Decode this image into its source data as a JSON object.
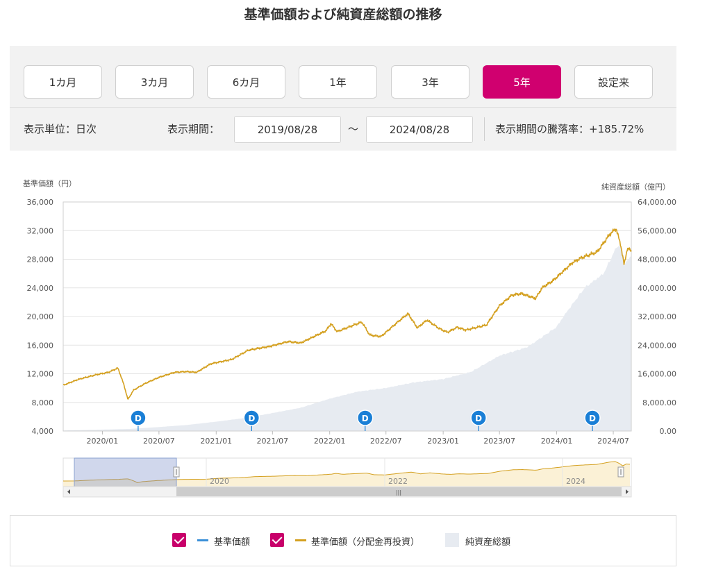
{
  "page": {
    "title": "基準価額および純資産総額の推移"
  },
  "period_buttons": [
    {
      "label": "1カ月",
      "active": false
    },
    {
      "label": "3カ月",
      "active": false
    },
    {
      "label": "6カ月",
      "active": false
    },
    {
      "label": "1年",
      "active": false
    },
    {
      "label": "3年",
      "active": false
    },
    {
      "label": "5年",
      "active": true
    },
    {
      "label": "設定来",
      "active": false
    }
  ],
  "controls": {
    "unit_label": "表示単位：日次",
    "period_label": "表示期間：",
    "start_date": "2019/08/28",
    "tilde": "～",
    "end_date": "2024/08/28",
    "change_label": "表示期間の騰落率：+185.72%"
  },
  "colors": {
    "accent": "#d0006f",
    "nav_reinvested_line": "#d4a020",
    "nav_line": "#3a8fd8",
    "net_assets_area": "#e7ebf1",
    "dividend_marker": "#1a7fd6"
  },
  "chart_data": {
    "type": "line",
    "left_axis_title": "基準価額（円）",
    "right_axis_title": "純資産総額（億円）",
    "left_ylim": [
      4000,
      36000
    ],
    "right_ylim": [
      0,
      64000
    ],
    "left_ticks": [
      "36,000",
      "32,000",
      "28,000",
      "24,000",
      "20,000",
      "16,000",
      "12,000",
      "8,000",
      "4,000"
    ],
    "right_ticks": [
      "64,000.00",
      "56,000.00",
      "48,000.00",
      "40,000.00",
      "32,000.00",
      "24,000.00",
      "16,000.00",
      "8,000.00",
      "0.00"
    ],
    "xlim": [
      "2019-08-28",
      "2024-08-28"
    ],
    "x_ticks": [
      {
        "date": "2020-01-01",
        "label": "2020/01"
      },
      {
        "date": "2020-07-01",
        "label": "2020/07"
      },
      {
        "date": "2021-01-01",
        "label": "2021/01"
      },
      {
        "date": "2021-07-01",
        "label": "2021/07"
      },
      {
        "date": "2022-01-01",
        "label": "2022/01"
      },
      {
        "date": "2022-07-01",
        "label": "2022/07"
      },
      {
        "date": "2023-01-01",
        "label": "2023/01"
      },
      {
        "date": "2023-07-01",
        "label": "2023/07"
      },
      {
        "date": "2024-01-01",
        "label": "2024/01"
      },
      {
        "date": "2024-07-01",
        "label": "2024/07"
      }
    ],
    "dividend_markers": {
      "label": "D",
      "dates": [
        "2020-04-25",
        "2021-04-25",
        "2022-04-25",
        "2023-04-25",
        "2024-04-25"
      ]
    },
    "series": [
      {
        "name": "基準価額（分配金再投資）",
        "axis": "left",
        "points": [
          [
            "2019-08-28",
            10400
          ],
          [
            "2019-10-15",
            11200
          ],
          [
            "2019-12-15",
            11900
          ],
          [
            "2020-01-20",
            12200
          ],
          [
            "2020-02-20",
            12800
          ],
          [
            "2020-03-10",
            10500
          ],
          [
            "2020-03-23",
            8400
          ],
          [
            "2020-04-10",
            9700
          ],
          [
            "2020-05-20",
            10700
          ],
          [
            "2020-07-01",
            11500
          ],
          [
            "2020-08-20",
            12200
          ],
          [
            "2020-09-25",
            12300
          ],
          [
            "2020-10-30",
            12200
          ],
          [
            "2020-12-15",
            13400
          ],
          [
            "2021-02-20",
            14000
          ],
          [
            "2021-04-15",
            15300
          ],
          [
            "2021-06-20",
            15800
          ],
          [
            "2021-08-20",
            16500
          ],
          [
            "2021-09-30",
            16300
          ],
          [
            "2021-12-20",
            18000
          ],
          [
            "2022-01-05",
            19000
          ],
          [
            "2022-01-25",
            17900
          ],
          [
            "2022-03-25",
            18900
          ],
          [
            "2022-04-15",
            19200
          ],
          [
            "2022-05-10",
            17400
          ],
          [
            "2022-06-15",
            17200
          ],
          [
            "2022-08-15",
            19500
          ],
          [
            "2022-09-10",
            20400
          ],
          [
            "2022-10-10",
            18400
          ],
          [
            "2022-11-10",
            19500
          ],
          [
            "2022-12-20",
            18300
          ],
          [
            "2023-01-15",
            17800
          ],
          [
            "2023-02-15",
            18500
          ],
          [
            "2023-03-15",
            18100
          ],
          [
            "2023-05-20",
            18800
          ],
          [
            "2023-07-01",
            21500
          ],
          [
            "2023-08-10",
            23000
          ],
          [
            "2023-09-10",
            23200
          ],
          [
            "2023-10-25",
            22500
          ],
          [
            "2023-11-15",
            24000
          ],
          [
            "2023-12-20",
            25000
          ],
          [
            "2024-02-20",
            27500
          ],
          [
            "2024-03-20",
            28200
          ],
          [
            "2024-05-10",
            29000
          ],
          [
            "2024-06-20",
            31500
          ],
          [
            "2024-07-10",
            32300
          ],
          [
            "2024-07-25",
            30000
          ],
          [
            "2024-08-05",
            27200
          ],
          [
            "2024-08-15",
            29500
          ],
          [
            "2024-08-28",
            29200
          ]
        ]
      },
      {
        "name": "純資産総額",
        "axis": "right",
        "points": [
          [
            "2019-08-28",
            150
          ],
          [
            "2019-12-31",
            400
          ],
          [
            "2020-03-31",
            600
          ],
          [
            "2020-06-30",
            1100
          ],
          [
            "2020-09-30",
            1700
          ],
          [
            "2020-12-31",
            2600
          ],
          [
            "2021-03-31",
            3600
          ],
          [
            "2021-06-30",
            5000
          ],
          [
            "2021-09-30",
            6500
          ],
          [
            "2021-12-31",
            9000
          ],
          [
            "2022-03-31",
            11000
          ],
          [
            "2022-06-30",
            12000
          ],
          [
            "2022-09-30",
            13600
          ],
          [
            "2022-12-31",
            14500
          ],
          [
            "2023-03-31",
            16500
          ],
          [
            "2023-06-30",
            21000
          ],
          [
            "2023-09-30",
            23500
          ],
          [
            "2023-12-31",
            29000
          ],
          [
            "2024-01-31",
            33000
          ],
          [
            "2024-03-31",
            40000
          ],
          [
            "2024-05-31",
            44000
          ],
          [
            "2024-07-15",
            52000
          ],
          [
            "2024-07-31",
            50500
          ],
          [
            "2024-08-05",
            46500
          ],
          [
            "2024-08-15",
            47500
          ],
          [
            "2024-08-28",
            49000
          ]
        ]
      }
    ],
    "navigator": {
      "year_labels": [
        "2020",
        "2022",
        "2024"
      ],
      "scroll_handle": "|||"
    }
  },
  "legend": {
    "items": [
      {
        "label": "基準価額",
        "checked": true
      },
      {
        "label": "基準価額（分配金再投資）",
        "checked": true
      },
      {
        "label": "純資産総額"
      }
    ]
  }
}
